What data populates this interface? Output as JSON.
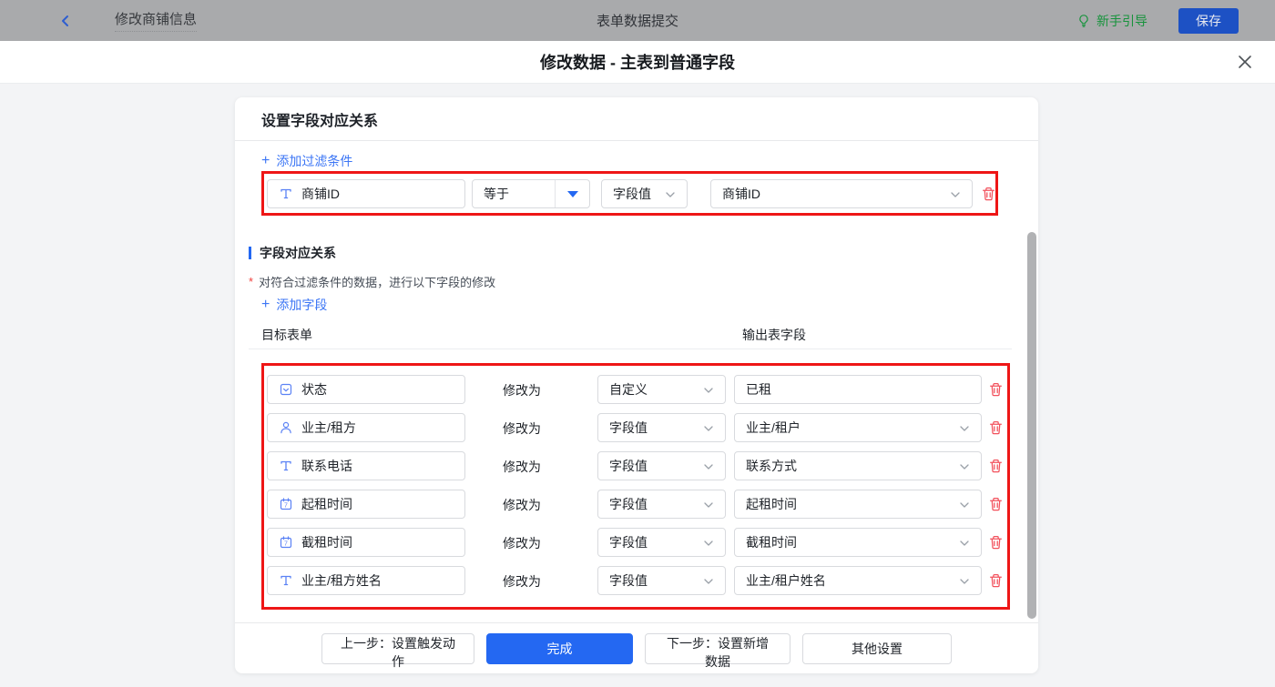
{
  "topbar": {
    "back": "修改商铺信息",
    "title": "表单数据提交",
    "guide": "新手引导",
    "save": "保存"
  },
  "dialog": {
    "title": "修改数据 - 主表到普通字段"
  },
  "panel": {
    "title": "设置字段对应关系",
    "plus": "+",
    "add_filter": "添加过滤条件",
    "add_field": "添加字段",
    "filter_row": {
      "field": "商铺ID",
      "operator": "等于",
      "value_type": "字段值",
      "value": "商铺ID"
    },
    "section_title": "字段对应关系",
    "required_mark": "*",
    "description": "对符合过滤条件的数据，进行以下字段的修改",
    "columns": {
      "left": "目标表单",
      "right": "输出表字段"
    },
    "modify_label": "修改为",
    "rows": [
      {
        "icon": "checkbox",
        "field": "状态",
        "type": "自定义",
        "value": "已租",
        "value_kind": "input"
      },
      {
        "icon": "person",
        "field": "业主/租方",
        "type": "字段值",
        "value": "业主/租户",
        "value_kind": "select"
      },
      {
        "icon": "text",
        "field": "联系电话",
        "type": "字段值",
        "value": "联系方式",
        "value_kind": "select"
      },
      {
        "icon": "calendar",
        "field": "起租时间",
        "type": "字段值",
        "value": "起租时间",
        "value_kind": "select"
      },
      {
        "icon": "calendar",
        "field": "截租时间",
        "type": "字段值",
        "value": "截租时间",
        "value_kind": "select"
      },
      {
        "icon": "text",
        "field": "业主/租方姓名",
        "type": "字段值",
        "value": "业主/租户姓名",
        "value_kind": "select"
      }
    ],
    "footer": {
      "prev": "上一步：设置触发动作",
      "done": "完成",
      "next": "下一步：设置新增数据",
      "other": "其他设置"
    }
  },
  "colors": {
    "accent": "#2468f2",
    "link": "#3c76f5",
    "danger": "#f2515c",
    "annotation": "#ee1616",
    "success": "#17933c",
    "topbar_bg": "#a9aaac"
  }
}
